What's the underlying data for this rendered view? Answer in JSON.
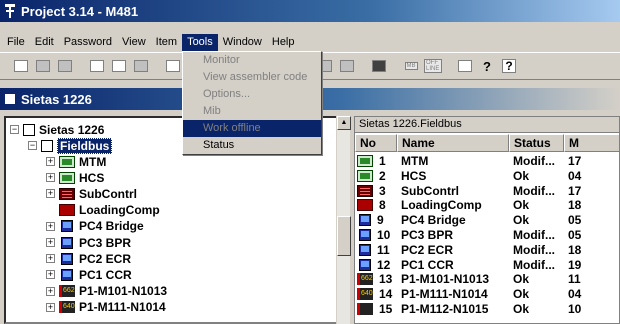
{
  "window": {
    "title": "Project 3.14 - M481"
  },
  "menu": {
    "items": [
      "File",
      "Edit",
      "Password",
      "View",
      "Item",
      "Tools",
      "Window",
      "Help"
    ],
    "active": "Tools"
  },
  "tools_menu": {
    "items": [
      {
        "label": "Monitor",
        "enabled": false
      },
      {
        "label": "View assembler code",
        "enabled": false
      },
      {
        "label": "Options...",
        "enabled": false
      },
      {
        "label": "Mib",
        "enabled": false
      },
      {
        "label": "Work offline",
        "enabled": false,
        "highlighted": true
      },
      {
        "label": "Status",
        "enabled": true
      }
    ]
  },
  "toolbar": {
    "icons": [
      "new-icon",
      "open-icon",
      "save-icon",
      "cut-icon",
      "copy-icon",
      "paste-icon",
      "undo-icon",
      "connect-icon",
      "disconnect-icon",
      "module-icon",
      "mb-icon",
      "offline-icon",
      "print-icon",
      "help-icon",
      "context-help-icon"
    ],
    "mb_label": "MB",
    "offline_label": "OFF LINE"
  },
  "project_header": {
    "title": "Sietas 1226"
  },
  "tree": {
    "root": "Sietas 1226",
    "fieldbus": "Fieldbus",
    "nodes": [
      {
        "label": "MTM",
        "icon": "monitor-module-icon",
        "expandable": true
      },
      {
        "label": "HCS",
        "icon": "monitor-module-icon",
        "expandable": true
      },
      {
        "label": "SubContrl",
        "icon": "rack-icon",
        "expandable": true
      },
      {
        "label": "LoadingComp",
        "icon": "loading-comp-icon",
        "expandable": false
      },
      {
        "label": "PC4 Bridge",
        "icon": "pc-icon",
        "expandable": true
      },
      {
        "label": "PC3 BPR",
        "icon": "pc-icon",
        "expandable": true
      },
      {
        "label": "PC2 ECR",
        "icon": "pc-icon",
        "expandable": true
      },
      {
        "label": "PC1 CCR",
        "icon": "pc-icon",
        "expandable": true
      },
      {
        "label": "P1-M101-N1013",
        "icon": "device-icon",
        "badge": "662",
        "expandable": true
      },
      {
        "label": "P1-M111-N1014",
        "icon": "device-icon",
        "badge": "640",
        "expandable": true
      }
    ]
  },
  "fieldbus_panel": {
    "path": "Sietas 1226.Fieldbus",
    "columns": [
      "No",
      "Name",
      "Status",
      "M"
    ],
    "rows": [
      {
        "no": "1",
        "name": "MTM",
        "status": "Modif...",
        "m": "17",
        "icon": "monitor-module-icon"
      },
      {
        "no": "2",
        "name": "HCS",
        "status": "Ok",
        "m": "04",
        "icon": "monitor-module-icon"
      },
      {
        "no": "3",
        "name": "SubContrl",
        "status": "Modif...",
        "m": "17",
        "icon": "rack-icon"
      },
      {
        "no": "8",
        "name": "LoadingComp",
        "status": "Ok",
        "m": "18",
        "icon": "loading-comp-icon"
      },
      {
        "no": "9",
        "name": "PC4 Bridge",
        "status": "Ok",
        "m": "05",
        "icon": "pc-icon"
      },
      {
        "no": "10",
        "name": "PC3 BPR",
        "status": "Modif...",
        "m": "05",
        "icon": "pc-icon"
      },
      {
        "no": "11",
        "name": "PC2 ECR",
        "status": "Modif...",
        "m": "18",
        "icon": "pc-icon"
      },
      {
        "no": "12",
        "name": "PC1 CCR",
        "status": "Modif...",
        "m": "19",
        "icon": "pc-icon"
      },
      {
        "no": "13",
        "name": "P1-M101-N1013",
        "status": "Ok",
        "m": "11",
        "icon": "device-icon",
        "badge": "662"
      },
      {
        "no": "14",
        "name": "P1-M111-N1014",
        "status": "Ok",
        "m": "04",
        "icon": "device-icon",
        "badge": "640"
      },
      {
        "no": "15",
        "name": "P1-M112-N1015",
        "status": "Ok",
        "m": "10",
        "icon": "device-icon",
        "badge": ""
      }
    ]
  }
}
